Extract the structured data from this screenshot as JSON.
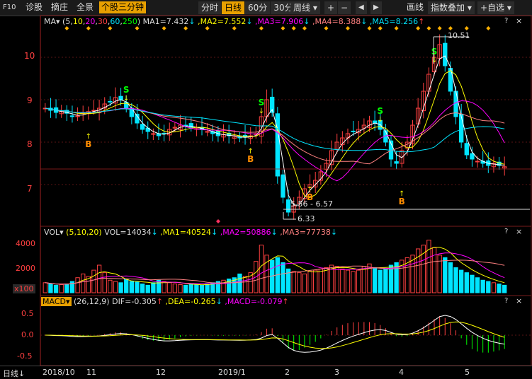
{
  "toolbar": {
    "f10": "F10",
    "zhengu": "诊股",
    "chaoye": "摘庄",
    "quanjing": "全景",
    "selected": "个股三分钟",
    "periods": [
      "分时",
      "日线",
      "60分",
      "30分"
    ],
    "active_period": "日线",
    "weekly": "周线",
    "plus": "+",
    "minus": "−",
    "back": "◀",
    "forward": "▶",
    "draw": "画线",
    "overlay": "指数叠加",
    "add_fav": "+自选"
  },
  "main_legend": {
    "ma": "MA",
    "params": [
      "5",
      "10",
      "20",
      "30",
      "60",
      "250"
    ],
    "ma1": "MA1=7.432",
    "ma2": ",MA2=7.552",
    "ma3": ",MA3=7.906",
    "ma4": ",MA4=8.388",
    "ma5": ",MA5=8.256"
  },
  "price_axis": [
    "10",
    "9",
    "8",
    "7"
  ],
  "annotations": {
    "high": "10.51",
    "low": "6.33",
    "range": "5.56 - 6.57"
  },
  "buy_label": "B",
  "sell_label": "S",
  "vol_legend": {
    "vol": "VOL",
    "params": "(5,10,20)",
    "vol_val": "VOL=14034",
    "ma1": ",MA1=40524",
    "ma2": ",MA2=50886",
    "ma3": ",MA3=77738"
  },
  "vol_axis": [
    "4000",
    "2000",
    "x100"
  ],
  "macd_legend": {
    "macd": "MACD",
    "params": "(26,12,9)",
    "dif": "DIF=-0.305",
    "dea": ",DEA=-0.265",
    "macd_val": ",MACD=-0.079"
  },
  "macd_axis": [
    "0.5",
    "0.0",
    "-0.5"
  ],
  "bottom": {
    "period": "日线",
    "dates": [
      "2018/10",
      "11",
      "12",
      "2019/1",
      "2",
      "3",
      "4",
      "5"
    ]
  },
  "panel_buttons": {
    "help": "?",
    "close": "×"
  },
  "colors": {
    "up": "#ff4040",
    "down": "#00e5ff",
    "accent": "#e8a000",
    "ma1": "#ffffff",
    "ma2": "#ffff00",
    "ma3": "#ff00ff",
    "ma4": "#ff8080",
    "ma5": "#00e5ff"
  },
  "chart_data": {
    "type": "candlestick",
    "x": [
      "2018/10",
      "11",
      "12",
      "2019/1",
      "2",
      "3",
      "4",
      "5"
    ],
    "ylim": [
      6.1,
      10.6
    ],
    "price_series": [
      8.8,
      8.75,
      8.7,
      8.72,
      8.68,
      8.6,
      8.62,
      8.7,
      8.72,
      8.75,
      8.8,
      8.9,
      8.95,
      9.05,
      9.0,
      8.8,
      8.6,
      8.45,
      8.3,
      8.25,
      8.2,
      8.15,
      8.2,
      8.3,
      8.35,
      8.4,
      8.38,
      8.35,
      8.32,
      8.3,
      8.25,
      8.2,
      8.15,
      8.18,
      8.15,
      8.12,
      8.1,
      8.12,
      8.15,
      8.2,
      8.6,
      9.0,
      8.7,
      7.2,
      6.7,
      6.35,
      6.5,
      6.7,
      6.9,
      7.0,
      7.1,
      7.3,
      7.5,
      7.8,
      8.0,
      8.1,
      8.2,
      8.25,
      8.3,
      8.4,
      8.5,
      8.45,
      8.3,
      8.0,
      7.6,
      7.5,
      7.8,
      8.0,
      8.4,
      8.8,
      9.2,
      9.6,
      10.0,
      10.3,
      9.8,
      9.2,
      8.6,
      8.0,
      7.7,
      7.6,
      7.55,
      7.5,
      7.45,
      7.5,
      7.45,
      7.42
    ],
    "volume_series": [
      800,
      700,
      600,
      650,
      700,
      900,
      1200,
      1500,
      1300,
      1800,
      2200,
      1600,
      1000,
      900,
      800,
      1100,
      900,
      850,
      700,
      600,
      800,
      1000,
      900,
      800,
      700,
      650,
      600,
      700,
      650,
      600,
      700,
      800,
      900,
      1000,
      1100,
      1200,
      1500,
      1300,
      1600,
      2500,
      3800,
      3000,
      2600,
      2800,
      2400,
      1900,
      1700,
      1600,
      1500,
      1700,
      1800,
      1900,
      2000,
      2200,
      2100,
      1900,
      1800,
      1700,
      1800,
      2100,
      2300,
      2000,
      1800,
      1900,
      2200,
      2400,
      2600,
      2800,
      3000,
      3500,
      3800,
      4200,
      3600,
      3000,
      2800,
      2400,
      2000,
      1800,
      1600,
      1400,
      1200,
      1000,
      900,
      800,
      700,
      600
    ],
    "markers": [
      {
        "type": "B",
        "price": 8.35
      },
      {
        "type": "S",
        "price": 9.0
      },
      {
        "type": "S",
        "price": 8.7
      },
      {
        "type": "B",
        "price": 8.0
      },
      {
        "type": "B",
        "price": 7.1
      },
      {
        "type": "S",
        "price": 8.5
      },
      {
        "type": "B",
        "price": 7.0
      },
      {
        "type": "S",
        "price": 9.9
      }
    ]
  }
}
